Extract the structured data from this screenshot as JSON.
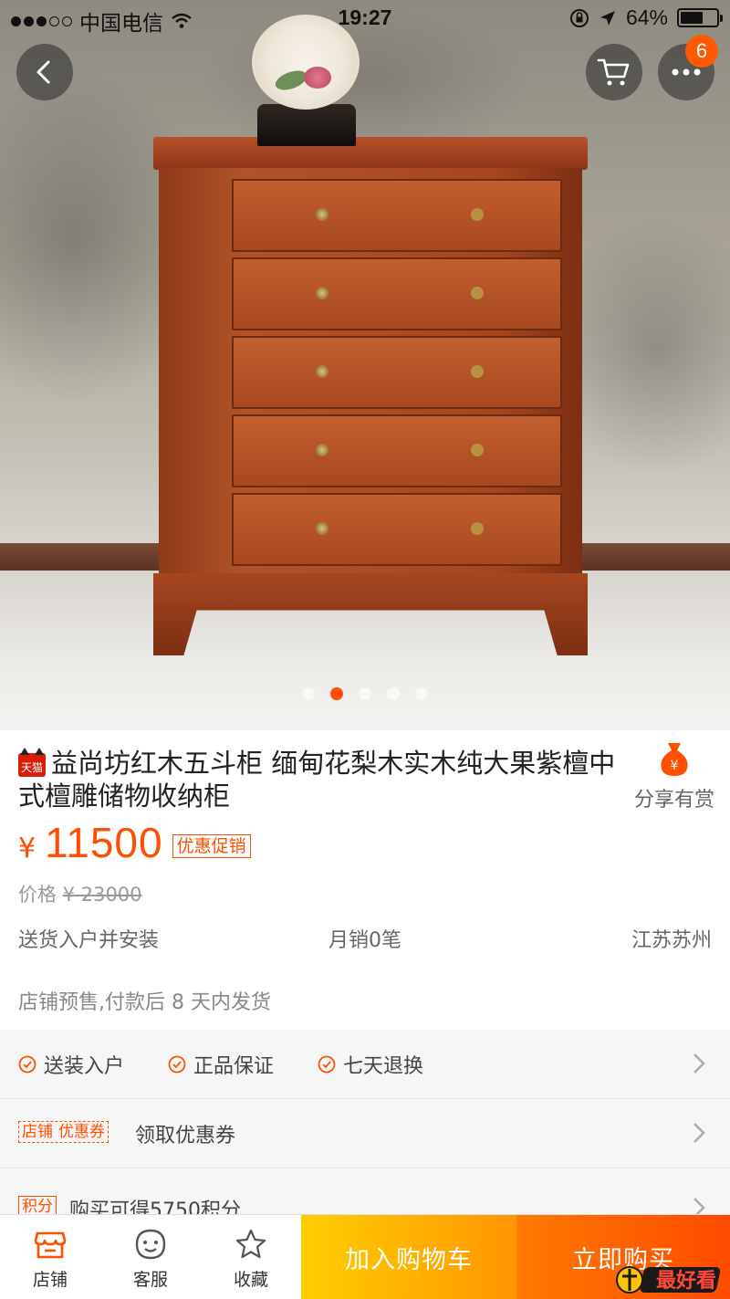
{
  "status_bar": {
    "carrier": "中国电信",
    "time": "19:27",
    "battery": "64%",
    "battery_level": 0.64
  },
  "hero": {
    "cart_badge_count": "6",
    "carousel_total": 5,
    "carousel_active": 2
  },
  "product": {
    "store_badge": "天猫",
    "title": "益尚坊红木五斗柜 缅甸花梨木实木纯大果紫檀中式檀雕储物收纳柜",
    "share_label": "分享有赏",
    "currency": "¥",
    "price": "11500",
    "promo_tag": "优惠促销",
    "original_price_label": "价格",
    "original_price": "¥ 23000",
    "delivery": "送货入户并安装",
    "monthly_sales": "月销0笔",
    "location": "江苏苏州",
    "presale_note": "店铺预售,付款后 8 天内发货"
  },
  "services": {
    "items": [
      "送装入户",
      "正品保证",
      "七天退换"
    ]
  },
  "coupon": {
    "tag_left": "店铺",
    "tag_right": "优惠券",
    "text": "领取优惠券"
  },
  "points": {
    "tag": "积分",
    "text": "购买可得5750积分"
  },
  "bottom_bar": {
    "shop_label": "店铺",
    "service_label": "客服",
    "favorite_label": "收藏",
    "add_to_cart": "加入购物车",
    "buy_now": "立即购买"
  },
  "watermark": "最好看",
  "colors": {
    "accent": "#ff5000",
    "cart_button": "#ffb000",
    "buy_button": "#ff5a00"
  }
}
